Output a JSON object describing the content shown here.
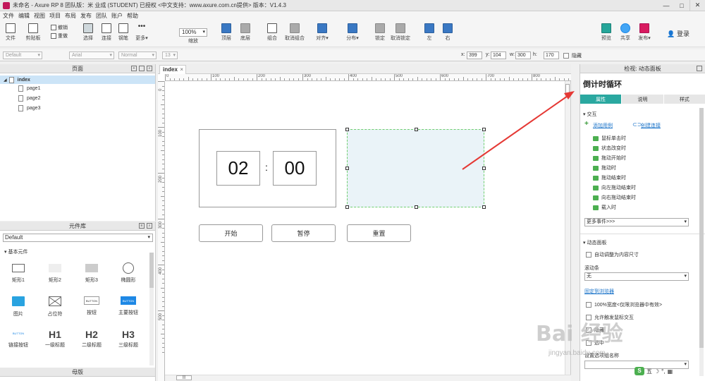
{
  "window": {
    "title": "未命名 - Axure RP 8 团队版：米 业成 (STUDENT) 已授权    <中文支持：www.axure.com.cn提供> 版本：V1.4.3"
  },
  "menu": [
    "文件",
    "编辑",
    "视图",
    "项目",
    "布局",
    "发布",
    "团队",
    "账户",
    "帮助"
  ],
  "toolbar": {
    "items": [
      {
        "label": "文件",
        "icon": "file-icon"
      },
      {
        "label": "剪贴板",
        "icon": "clipboard-icon"
      },
      {
        "label": "选择",
        "icon": "select-icon"
      },
      {
        "label": "连接",
        "icon": "connect-icon"
      },
      {
        "label": "钢笔",
        "icon": "pen-icon"
      },
      {
        "label": "更多▾",
        "icon": "more-icon"
      },
      {
        "label": "缩放",
        "icon": "zoom-icon"
      },
      {
        "label": "顶层",
        "icon": "bring-front-icon"
      },
      {
        "label": "底层",
        "icon": "send-back-icon"
      },
      {
        "label": "组合",
        "icon": "group-icon"
      },
      {
        "label": "取消组合",
        "icon": "ungroup-icon"
      },
      {
        "label": "对齐▾",
        "icon": "align-icon"
      },
      {
        "label": "分布▾",
        "icon": "distribute-icon"
      },
      {
        "label": "锁定",
        "icon": "lock-icon"
      },
      {
        "label": "取消锁定",
        "icon": "unlock-icon"
      },
      {
        "label": "左",
        "icon": "left-icon"
      },
      {
        "label": "右",
        "icon": "right-icon"
      },
      {
        "label": "预览",
        "icon": "preview-icon"
      },
      {
        "label": "共享",
        "icon": "share-icon"
      },
      {
        "label": "发布▾",
        "icon": "publish-icon"
      }
    ],
    "undo": "撤销",
    "redo": "重做",
    "zoom": "100%",
    "login": "登录"
  },
  "format": {
    "style": "Default",
    "font": "Arial",
    "weight": "Normal",
    "size": "13",
    "x_label": "x:",
    "x": "399",
    "y_label": "y:",
    "y": "104",
    "w_label": "w:",
    "w": "300",
    "h_label": "h:",
    "h": "170",
    "hidden": "隐藏"
  },
  "pages_panel": {
    "title": "页面",
    "items": [
      {
        "label": "index",
        "selected": true
      },
      {
        "label": "page1"
      },
      {
        "label": "page2"
      },
      {
        "label": "page3"
      }
    ]
  },
  "library": {
    "title": "元件库",
    "selected": "Default",
    "section": "基本元件",
    "widgets": [
      {
        "label": "矩形1",
        "icon": "rectangle-icon"
      },
      {
        "label": "矩形2",
        "icon": "rectangle-filled-icon"
      },
      {
        "label": "矩形3",
        "icon": "rectangle-grey-icon"
      },
      {
        "label": "椭圆形",
        "icon": "ellipse-icon"
      },
      {
        "label": "图片",
        "icon": "image-icon"
      },
      {
        "label": "占位符",
        "icon": "placeholder-icon"
      },
      {
        "label": "按钮",
        "icon": "button-icon",
        "text": "BUTTON"
      },
      {
        "label": "主要按钮",
        "icon": "primary-button-icon",
        "text": "BUTTON"
      },
      {
        "label": "链接按钮",
        "icon": "link-button-icon",
        "text": "BUTTON"
      },
      {
        "label": "一级标题",
        "icon": "h1-icon",
        "text": "H1"
      },
      {
        "label": "二级标题",
        "icon": "h2-icon",
        "text": "H2"
      },
      {
        "label": "三级标题",
        "icon": "h3-icon",
        "text": "H3"
      }
    ],
    "bottom_tab": "母版"
  },
  "canvas": {
    "tab": "index",
    "ruler_h": [
      "0",
      "100",
      "200",
      "300",
      "400",
      "500",
      "600",
      "700",
      "800"
    ],
    "ruler_v": [
      "0",
      "100",
      "200",
      "300",
      "400",
      "500"
    ],
    "timer": {
      "minutes": "02",
      "colon": ":",
      "seconds": "00"
    },
    "buttons": [
      "开始",
      "暂停",
      "重置"
    ]
  },
  "inspector": {
    "header": "检视: 动态面板",
    "name": "倒计时循环",
    "tabs": [
      "属性",
      "说明",
      "样式"
    ],
    "interaction_title": "交互",
    "add_case": "添加用例",
    "create_link": "创建连接",
    "events": [
      "鼠标单击时",
      "状态改变时",
      "拖动开始时",
      "拖动时",
      "拖动结束时",
      "向左拖动结束时",
      "向右拖动结束时",
      "载入时"
    ],
    "more_events": "更多事件>>>",
    "dynamic_panel_title": "动态面板",
    "auto_fit": "自动调整为内容尺寸",
    "scrollbar_label": "滚动条",
    "scrollbar_value": "无",
    "pin_link": "固定到浏览器",
    "full_width": "100%宽度<仅限浏览器中有效>",
    "allow_mouse": "允许触发鼠标交互",
    "check3": "隐藏",
    "check4": "选中",
    "group_label": "设置选项组名称"
  },
  "watermark": {
    "main": "Bai 经验",
    "sub": "jingyan.baidu.com"
  },
  "taskbar": {
    "ime": "五"
  },
  "colors": {
    "accent": "#2aa8a0",
    "link": "#1a73c9",
    "arrow": "#e53935",
    "panel_fill": "#eaf3f8",
    "panel_border": "#6fcf6f"
  }
}
